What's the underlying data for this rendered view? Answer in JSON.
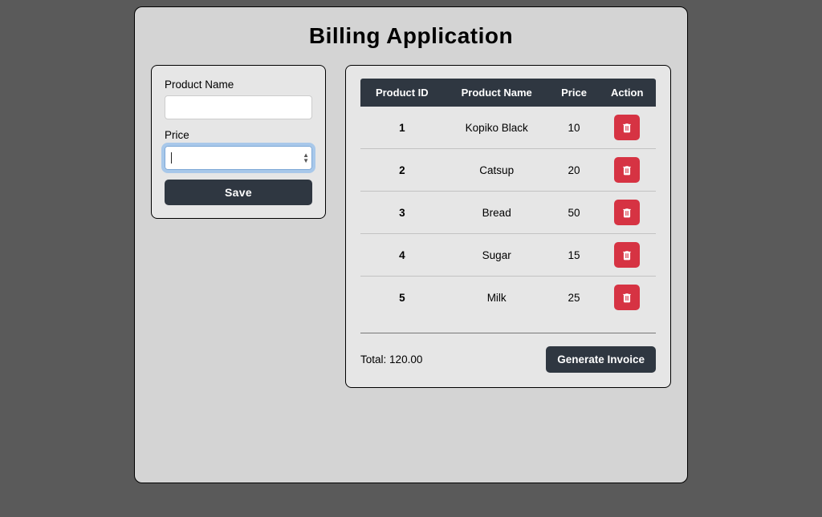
{
  "app_title": "Billing Application",
  "form": {
    "product_name_label": "Product Name",
    "product_name_value": "",
    "price_label": "Price",
    "price_value": "",
    "save_button": "Save"
  },
  "table": {
    "headers": {
      "id": "Product ID",
      "name": "Product Name",
      "price": "Price",
      "action": "Action"
    },
    "rows": [
      {
        "id": "1",
        "name": "Kopiko Black",
        "price": "10"
      },
      {
        "id": "2",
        "name": "Catsup",
        "price": "20"
      },
      {
        "id": "3",
        "name": "Bread",
        "price": "50"
      },
      {
        "id": "4",
        "name": "Sugar",
        "price": "15"
      },
      {
        "id": "5",
        "name": "Milk",
        "price": "25"
      }
    ]
  },
  "footer": {
    "total_label": "Total:",
    "total_value": "120.00",
    "generate_invoice": "Generate Invoice"
  },
  "colors": {
    "danger": "#d63343",
    "dark": "#2f3741",
    "panel": "#d4d4d4",
    "card": "#e6e6e6"
  }
}
